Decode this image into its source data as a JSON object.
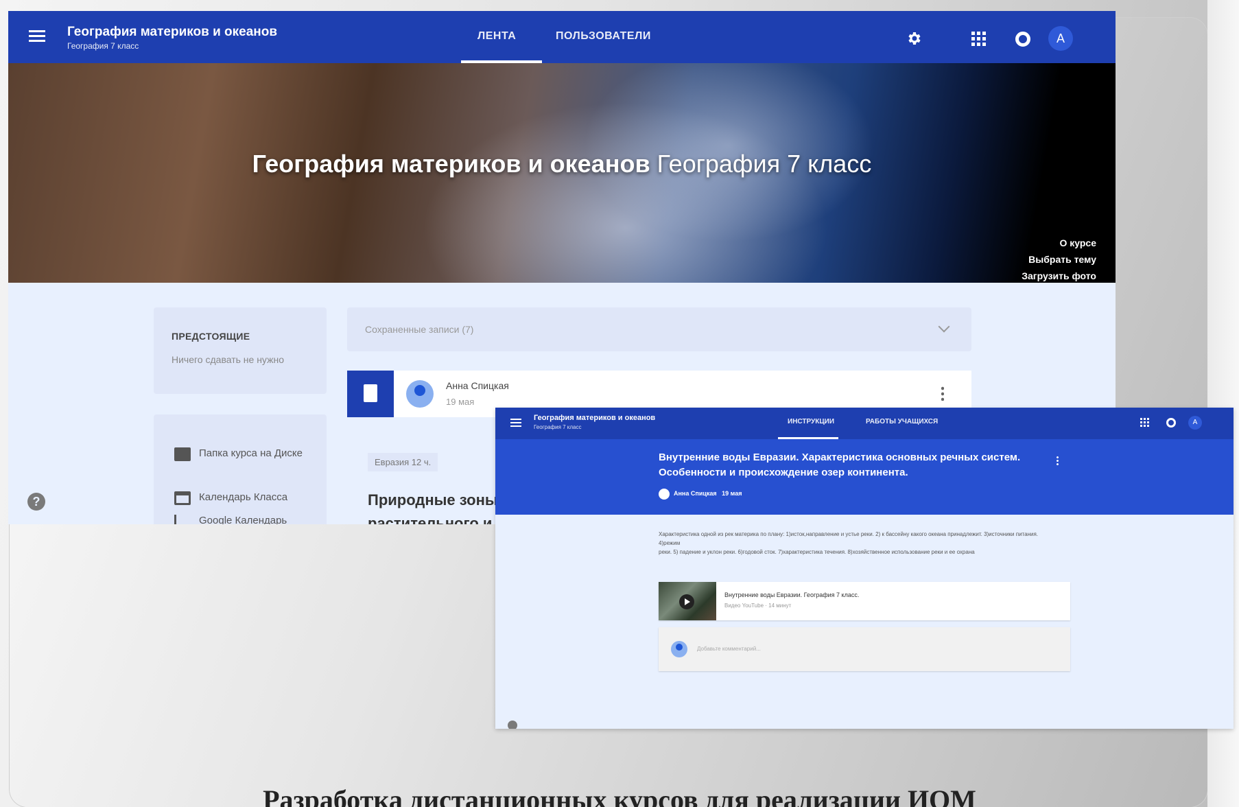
{
  "caption": "Разработка дистанционных курсов для реализации ИОМ",
  "main": {
    "topbar": {
      "title": "География материков и океанов",
      "subtitle": "География 7 класс",
      "tabs": [
        "ЛЕНТА",
        "ПОЛЬЗОВАТЕЛИ"
      ],
      "avatar_letter": "A"
    },
    "banner": {
      "title_bold": "География материков и океанов",
      "title_regular": "География 7 класс",
      "links": [
        "О курсе",
        "Выбрать тему",
        "Загрузить фото"
      ]
    },
    "upcoming": {
      "heading": "ПРЕДСТОЯЩИЕ",
      "text": "Ничего сдавать не нужно"
    },
    "links": [
      "Папка курса на Диске",
      "Календарь Класса",
      "Google Календарь"
    ],
    "help": "?",
    "saved": "Сохраненные записи (7)",
    "post": {
      "author": "Анна Спицкая",
      "date": "19 мая",
      "tag": "Евразия 12 ч.",
      "title": "Природные зоны растительного и"
    }
  },
  "overlay": {
    "topbar": {
      "title": "География материков и океанов",
      "subtitle": "География 7 класс",
      "tabs": [
        "ИНСТРУКЦИИ",
        "РАБОТЫ УЧАЩИХСЯ"
      ],
      "avatar_letter": "A"
    },
    "assignment": {
      "title": "Внутренние воды Евразии. Характеристика основных речных систем. Особенности и происхождение озер континента.",
      "author": "Анна Спицкая",
      "date": "19 мая",
      "description_line1": "Характеристика одной из рек материка по плану: 1)исток,направление и устье реки. 2) к бассейну какого океана принадлежит. 3)источники питания. 4)режим",
      "description_line2": "реки. 5) падение и уклон реки. 6)годовой сток. 7)характеристика течения. 8)хозяйственное использование реки и ее охрана"
    },
    "video": {
      "title": "Внутренние воды Евразии. География 7 класс.",
      "meta": "Видео YouTube · 14 минут"
    },
    "comment_placeholder": "Добавьте комментарий..."
  }
}
